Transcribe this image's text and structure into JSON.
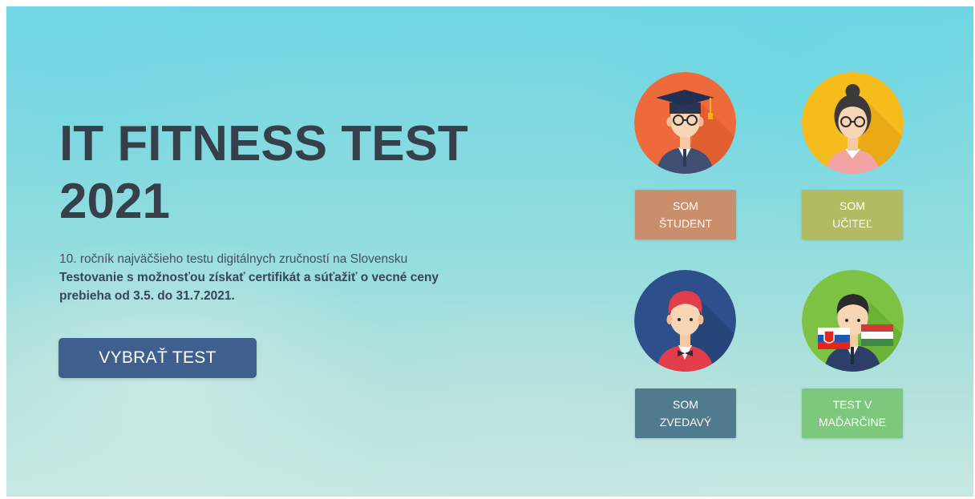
{
  "hero": {
    "title_line1": "IT FITNESS TEST",
    "title_line2": "2021",
    "subtitle": "10. ročník najväčšieho testu digitálnych zručností na Slovensku",
    "highlight_line1": "Testovanie s možnosťou získať certifikát a súťažiť o vecné ceny",
    "highlight_line2": "prebieha od 3.5. do 31.7.2021.",
    "cta_label": "VYBRAŤ TEST"
  },
  "roles": [
    {
      "line1": "SOM",
      "line2": "ŠTUDENT",
      "icon": "student-avatar-icon",
      "button_color": "#c98f6c",
      "circle_color": "#ee6a3b"
    },
    {
      "line1": "SOM",
      "line2": "UČITEĽ",
      "icon": "teacher-avatar-icon",
      "button_color": "#b2bb62",
      "circle_color": "#f5bc1c"
    },
    {
      "line1": "SOM",
      "line2": "ZVEDAVÝ",
      "icon": "curious-avatar-icon",
      "button_color": "#507b8f",
      "circle_color": "#2d4f8b"
    },
    {
      "line1": "TEST V",
      "line2": "MAĎARČINE",
      "icon": "hungarian-test-avatar-icon",
      "button_color": "#7ec87e",
      "circle_color": "#7dc242"
    }
  ]
}
